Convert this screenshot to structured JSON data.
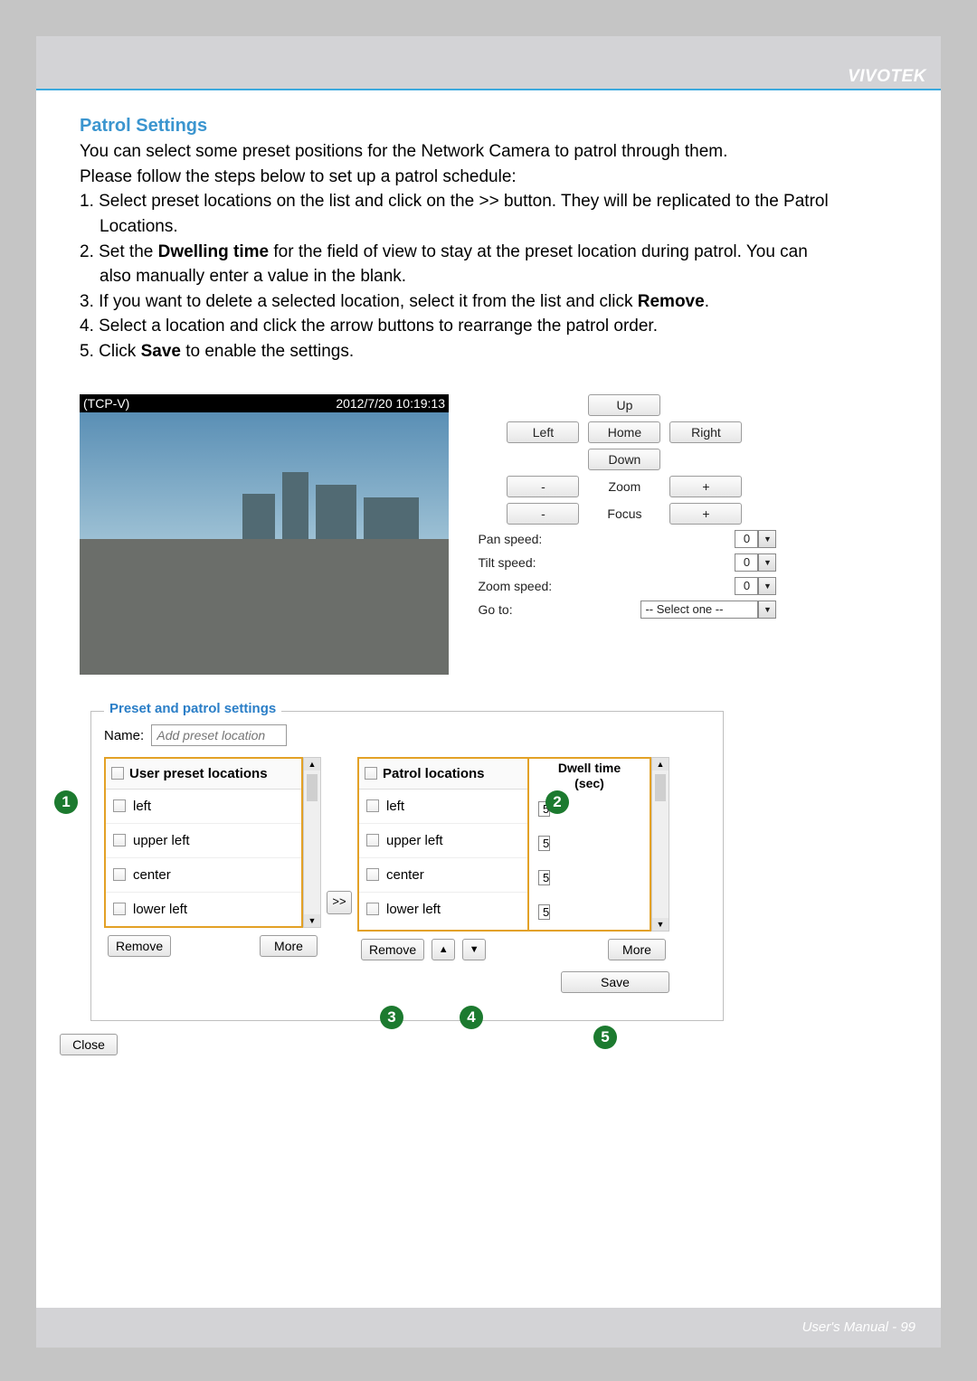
{
  "brand": "VIVOTEK",
  "section_title": "Patrol Settings",
  "intro_line1": "You can select some preset positions for the Network Camera to patrol through them.",
  "intro_line2": "Please follow the steps below to set up a patrol schedule:",
  "steps": {
    "s1": "1. Select preset locations on the list and click on the >> button. They will be replicated to the Patrol",
    "s1b": "Locations.",
    "s2a": "2. Set the ",
    "s2bold": "Dwelling time",
    "s2b": " for the field of view to stay at the preset location during patrol. You can",
    "s2c": "also manually enter a value in the blank.",
    "s3a": "3. If you want to delete a selected location, select it from the list and click ",
    "s3bold": "Remove",
    "s3b": ".",
    "s4": "4. Select a location and click the arrow buttons to rearrange the patrol order.",
    "s5a": "5. Click ",
    "s5bold": "Save",
    "s5b": " to enable the settings."
  },
  "video": {
    "title": "(TCP-V)",
    "timestamp": "2012/7/20 10:19:13"
  },
  "ctrl": {
    "up": "Up",
    "left": "Left",
    "home": "Home",
    "right": "Right",
    "down": "Down",
    "minus": "-",
    "zoom": "Zoom",
    "plus": "+",
    "focus": "Focus",
    "pan_speed": "Pan speed:",
    "tilt_speed": "Tilt speed:",
    "zoom_speed": "Zoom speed:",
    "goto": "Go to:",
    "goto_val": "-- Select one --",
    "speed_val": "0"
  },
  "settings": {
    "legend": "Preset and patrol settings",
    "name_label": "Name:",
    "name_placeholder": "Add preset location",
    "user_preset_header": "User preset locations",
    "patrol_header": "Patrol locations",
    "dwell_h1": "Dwell time",
    "dwell_h2": "(sec)",
    "items": [
      "left",
      "upper left",
      "center",
      "lower left"
    ],
    "dwell_val": "5",
    "remove": "Remove",
    "more": "More",
    "save": "Save",
    "close": "Close",
    "move": ">>",
    "up_arrow": "▲",
    "down_arrow": "▼"
  },
  "callouts": {
    "c1": "1",
    "c2": "2",
    "c3": "3",
    "c4": "4",
    "c5": "5"
  },
  "footer": {
    "label": "User's Manual - ",
    "page": "99"
  }
}
